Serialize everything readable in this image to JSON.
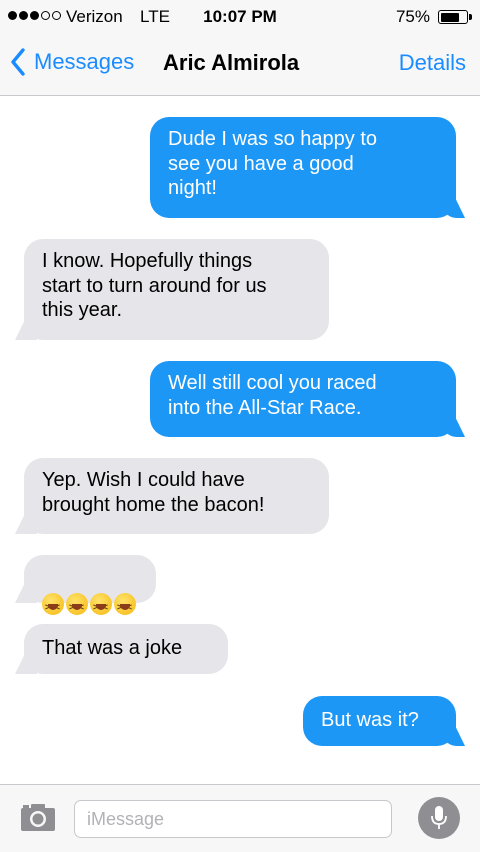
{
  "status_bar": {
    "carrier": "Verizon",
    "network": "LTE",
    "time": "10:07 PM",
    "battery_percent": "75%",
    "battery_level": 0.75,
    "signal_bars_filled": 3,
    "signal_bars_total": 5
  },
  "nav": {
    "back_label": "Messages",
    "title": "Aric Almirola",
    "details_label": "Details"
  },
  "messages": [
    {
      "direction": "sent",
      "text": "Dude I was so happy to\nsee you have a good\nnight!"
    },
    {
      "direction": "received",
      "text": "I know. Hopefully things\nstart to turn around for us\nthis year."
    },
    {
      "direction": "sent",
      "text": "Well still cool you raced\ninto the All-Star Race."
    },
    {
      "direction": "received",
      "text": "Yep. Wish I could have\nbrought home the bacon!"
    },
    {
      "direction": "received",
      "text": "😆😆😆😆",
      "emoji_icons": [
        "laughing-face-icon",
        "laughing-face-icon",
        "laughing-face-icon",
        "laughing-face-icon"
      ]
    },
    {
      "direction": "received",
      "text": "That was a joke"
    },
    {
      "direction": "sent",
      "text": "But was it?"
    }
  ],
  "input_bar": {
    "placeholder": "iMessage",
    "camera_icon": "camera-icon",
    "mic_icon": "microphone-icon"
  },
  "colors": {
    "sent_bubble": "#1d97f5",
    "received_bubble": "#e5e5ea",
    "accent": "#1a8cff",
    "bar_background": "#f7f7f8"
  }
}
